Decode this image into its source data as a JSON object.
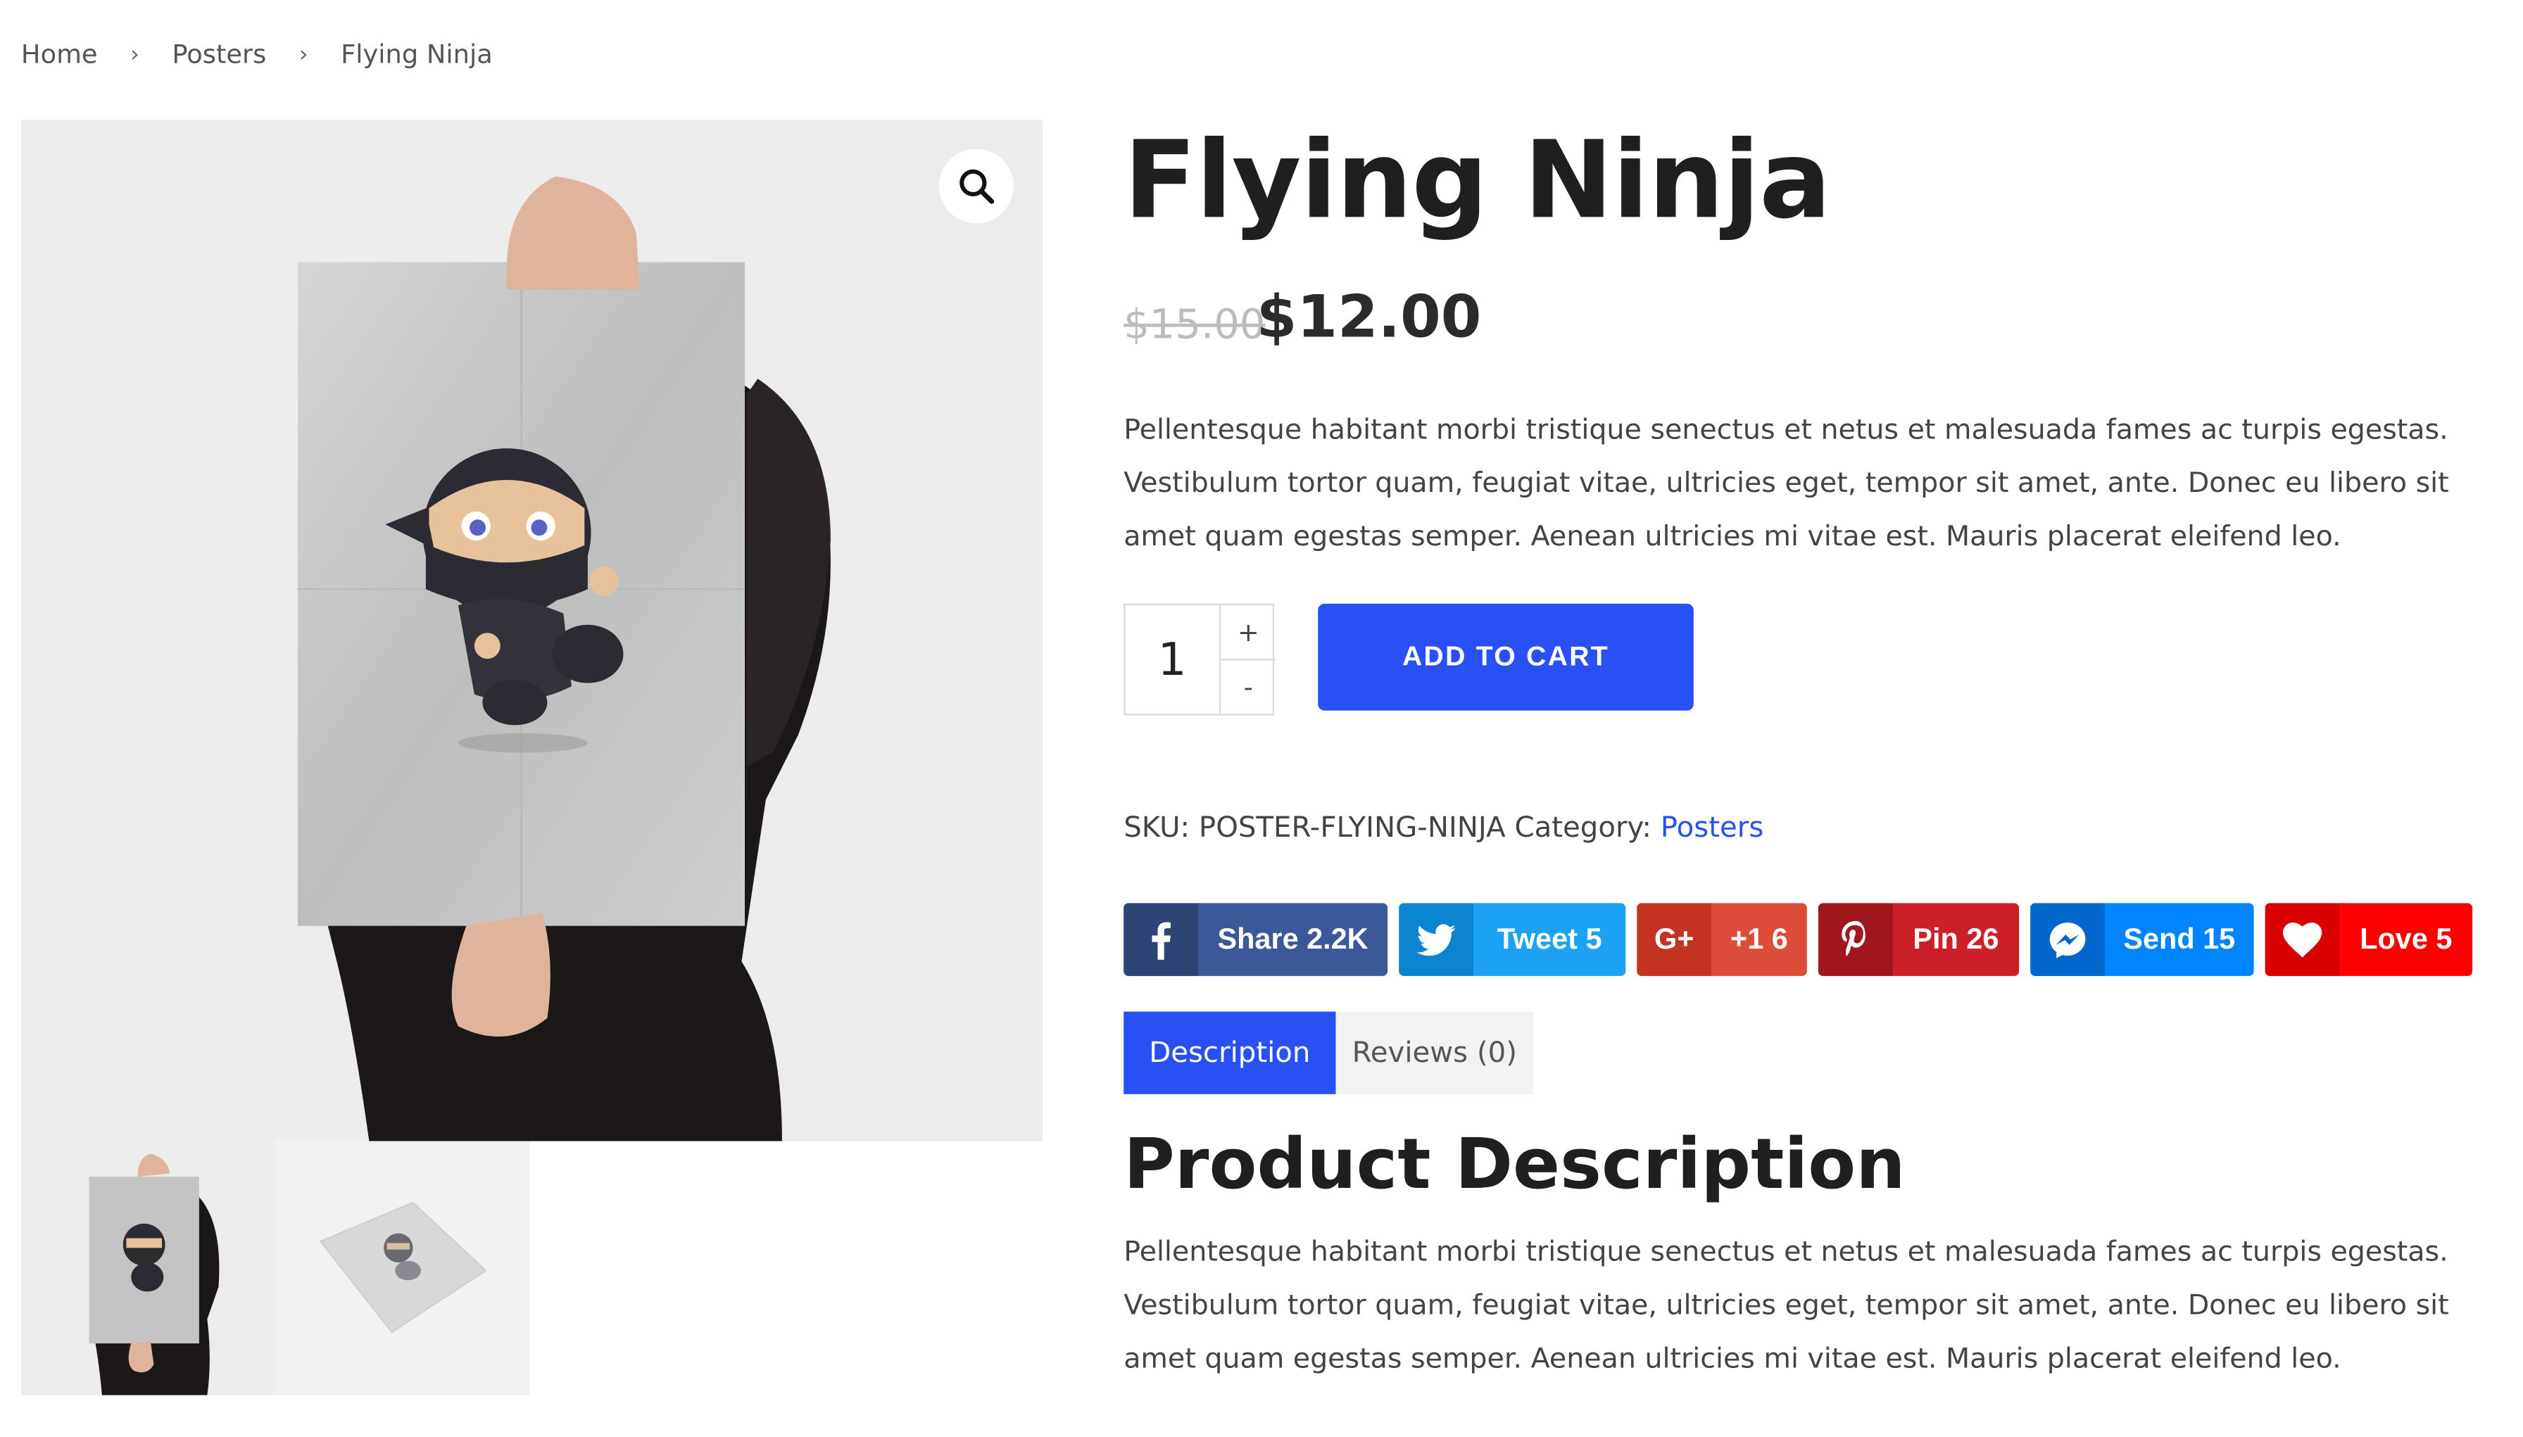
{
  "breadcrumb": {
    "home": "Home",
    "category": "Posters",
    "current": "Flying Ninja",
    "separator": "›"
  },
  "gallery": {
    "zoom_icon": "magnifier-icon",
    "thumbnail_count": 2
  },
  "product": {
    "title": "Flying Ninja",
    "price_old": "$15.00",
    "price_new": "$12.00",
    "short_description": "Pellentesque habitant morbi tristique senectus et netus et malesuada fames ac turpis egestas. Vestibulum tortor quam, feugiat vitae, ultricies eget, tempor sit amet, ante. Donec eu libero sit amet quam egestas semper. Aenean ultricies mi vitae est. Mauris placerat eleifend leo."
  },
  "quantity": {
    "value": "1",
    "plus": "+",
    "minus": "-"
  },
  "cart": {
    "button_label": "ADD TO CART"
  },
  "meta": {
    "sku_label": "SKU:",
    "sku_value": "POSTER-FLYING-NINJA",
    "category_label": "Category:",
    "category_value": "Posters"
  },
  "share": [
    {
      "label": "Share 2.2K",
      "icon": "facebook-icon",
      "color": "#3b5998",
      "icon_bg": "#2d4475"
    },
    {
      "label": "Tweet 5",
      "icon": "twitter-icon",
      "color": "#1da1f2",
      "icon_bg": "#0c85d0"
    },
    {
      "label": "+1 6",
      "icon": "google-plus-icon",
      "color": "#dd4b39",
      "icon_bg": "#c23321"
    },
    {
      "label": "Pin 26",
      "icon": "pinterest-icon",
      "color": "#cb2027",
      "icon_bg": "#a0171d"
    },
    {
      "label": "Send 15",
      "icon": "messenger-icon",
      "color": "#0084ff",
      "icon_bg": "#0068cc"
    },
    {
      "label": "Love 5",
      "icon": "heart-icon",
      "color": "#ff0000",
      "icon_bg": "#d90000"
    }
  ],
  "tabs": [
    {
      "label": "Description"
    },
    {
      "label": "Reviews (0)"
    }
  ],
  "description": {
    "heading": "Product Description",
    "text": "Pellentesque habitant morbi tristique senectus et netus et malesuada fames ac turpis egestas. Vestibulum tortor quam, feugiat vitae, ultricies eget, tempor sit amet, ante. Donec eu libero sit amet quam egestas semper. Aenean ultricies mi vitae est. Mauris placerat eleifend leo."
  },
  "colors": {
    "accent": "#2950f5"
  }
}
